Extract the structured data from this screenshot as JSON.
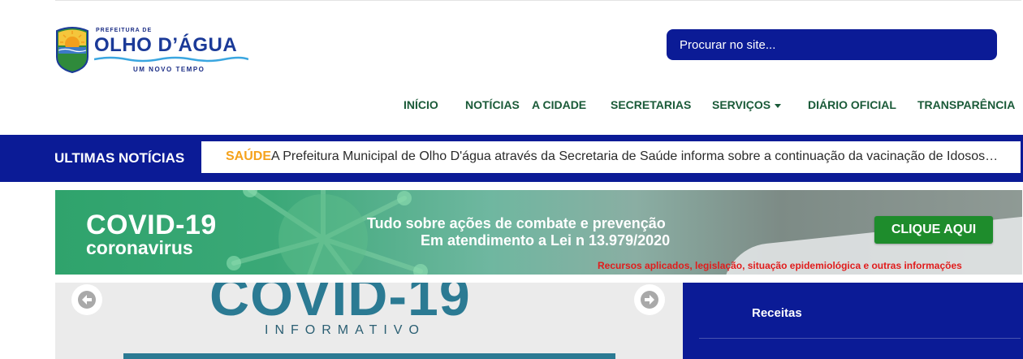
{
  "logo": {
    "small_text": "PREFEITURA DE",
    "name": "OLHO D’ÁGUA",
    "tagline": "UM NOVO TEMPO"
  },
  "search": {
    "placeholder": "Procurar no site..."
  },
  "nav": {
    "items": [
      "INÍCIO",
      "NOTÍCIAS",
      "A CIDADE",
      "SECRETARIAS",
      "SERVIÇOS",
      "DIÁRIO OFICIAL",
      "TRANSPARÊNCIA"
    ]
  },
  "news": {
    "heading": "ULTIMAS NOTÍCIAS",
    "tag": "SAÚDE",
    "text": "A Prefeitura Municipal de Olho D'água através da Secretaria de Saúde informa sobre a continuação da vacinação de Idosos…"
  },
  "banner": {
    "title": "COVID-19",
    "subtitle": "coronavirus",
    "line1": "Tudo sobre ações de combate e prevenção",
    "line2": "Em atendimento a Lei n 13.979/2020",
    "button": "CLIQUE AQUI",
    "note": "Recursos aplicados,  legislação,  situação epidemiológica e outras informações"
  },
  "slider": {
    "title": "COVID-19",
    "subtitle": "INFORMATIVO"
  },
  "side_panel": {
    "items": [
      "Receitas"
    ]
  },
  "colors": {
    "brand_blue": "#0b1b96",
    "nav_green": "#1a5a38",
    "tag_orange": "#f5a21c",
    "button_green": "#1e8c2c",
    "note_red": "#e11c1c"
  }
}
